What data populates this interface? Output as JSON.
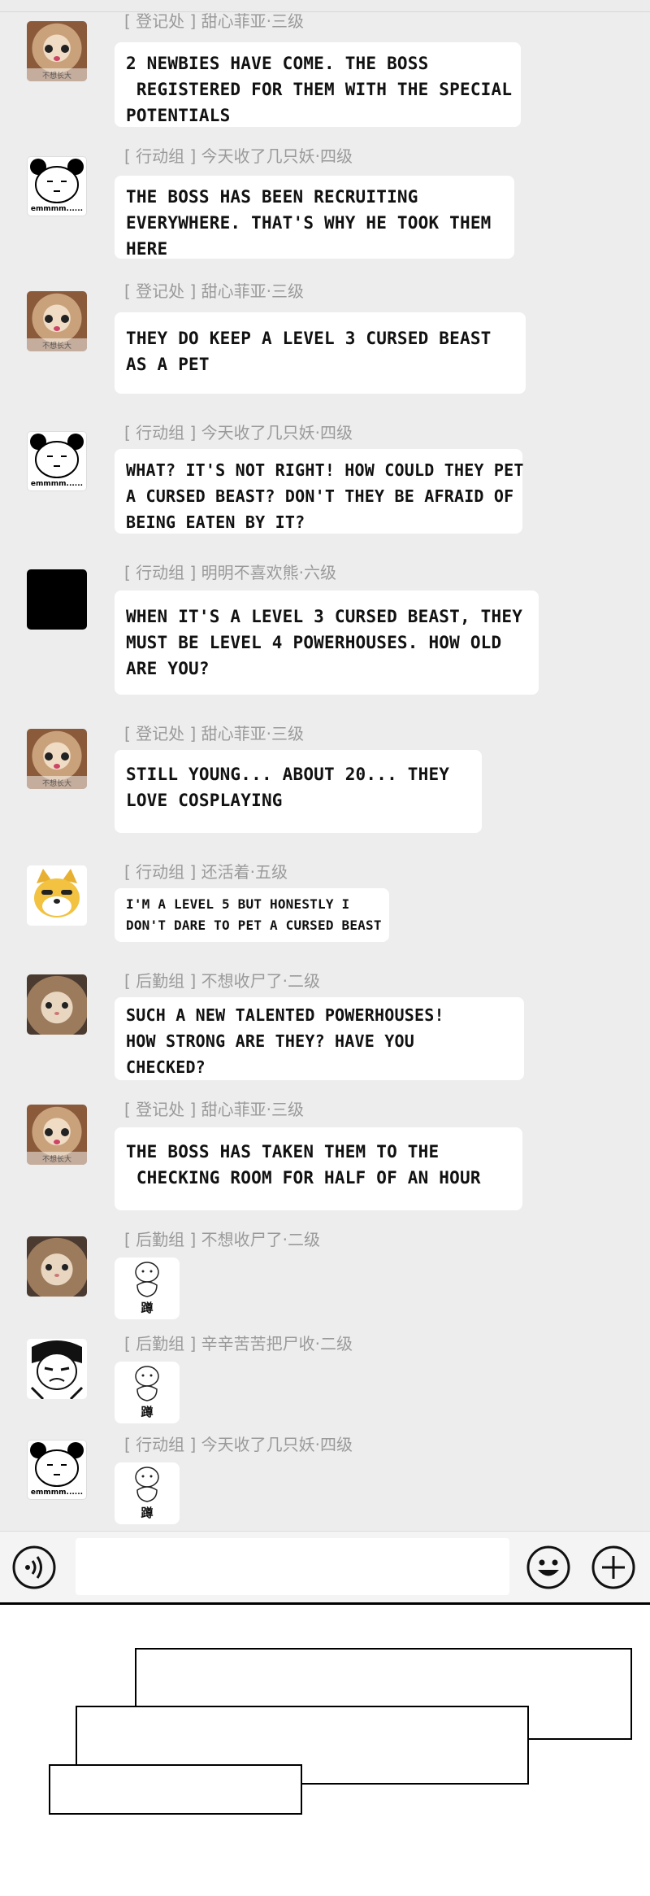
{
  "messages": [
    {
      "sender": "[ 登记处 ] 甜心菲亚·三级",
      "avatar": "cat",
      "lines": [
        "2 NEWBIES HAVE COME. THE BOSS",
        " REGISTERED FOR THEM WITH THE SPECIAL",
        "POTENTIALS"
      ]
    },
    {
      "sender": "[ 行动组 ] 今天收了几只妖·四级",
      "avatar": "panda",
      "lines": [
        "THE BOSS HAS BEEN RECRUITING",
        "EVERYWHERE. THAT'S WHY HE TOOK THEM",
        "HERE"
      ]
    },
    {
      "sender": "[ 登记处 ] 甜心菲亚·三级",
      "avatar": "cat",
      "lines": [
        "THEY DO KEEP A LEVEL 3 CURSED BEAST",
        "AS A PET"
      ]
    },
    {
      "sender": "[ 行动组 ] 今天收了几只妖·四级",
      "avatar": "panda",
      "lines": [
        "WHAT? IT'S NOT RIGHT! HOW COULD THEY PET",
        "A CURSED BEAST? DON'T THEY BE AFRAID OF",
        "BEING EATEN BY IT?"
      ]
    },
    {
      "sender": "[ 行动组 ] 明明不喜欢熊·六级",
      "avatar": "black",
      "lines": [
        "WHEN IT'S A LEVEL 3 CURSED BEAST, THEY",
        "MUST BE LEVEL 4 POWERHOUSES. HOW OLD",
        "ARE YOU?"
      ]
    },
    {
      "sender": "[ 登记处 ] 甜心菲亚·三级",
      "avatar": "cat",
      "lines": [
        "STILL YOUNG... ABOUT 20... THEY",
        "LOVE COSPLAYING"
      ]
    },
    {
      "sender": "[ 行动组 ] 还活着·五级",
      "avatar": "doge",
      "lines": [
        "I'M A LEVEL 5 BUT HONESTLY I",
        "DON'T DARE TO PET A CURSED BEAST"
      ]
    },
    {
      "sender": "[ 后勤组 ] 不想收尸了·二级",
      "avatar": "kitten",
      "lines": [
        "SUCH A NEW TALENTED POWERHOUSES!",
        "HOW STRONG ARE THEY? HAVE YOU",
        "CHECKED?"
      ]
    },
    {
      "sender": "[ 登记处 ] 甜心菲亚·三级",
      "avatar": "cat",
      "lines": [
        "THE BOSS HAS TAKEN THEM TO THE",
        " CHECKING ROOM FOR HALF OF AN HOUR"
      ]
    },
    {
      "sender": "[ 后勤组 ] 不想收尸了·二级",
      "avatar": "kitten",
      "sticker": "蹲"
    },
    {
      "sender": "[ 后勤组 ] 辛辛苦苦把尸收·二级",
      "avatar": "manga",
      "sticker": "蹲"
    },
    {
      "sender": "[ 行动组 ] 今天收了几只妖·四级",
      "avatar": "panda",
      "sticker": "蹲"
    }
  ],
  "panda_caption": "emmmm......",
  "cat_caption": "不想长大",
  "input": {
    "voice_icon": "voice-icon",
    "emoji_icon": "emoji-icon",
    "plus_icon": "plus-icon"
  }
}
